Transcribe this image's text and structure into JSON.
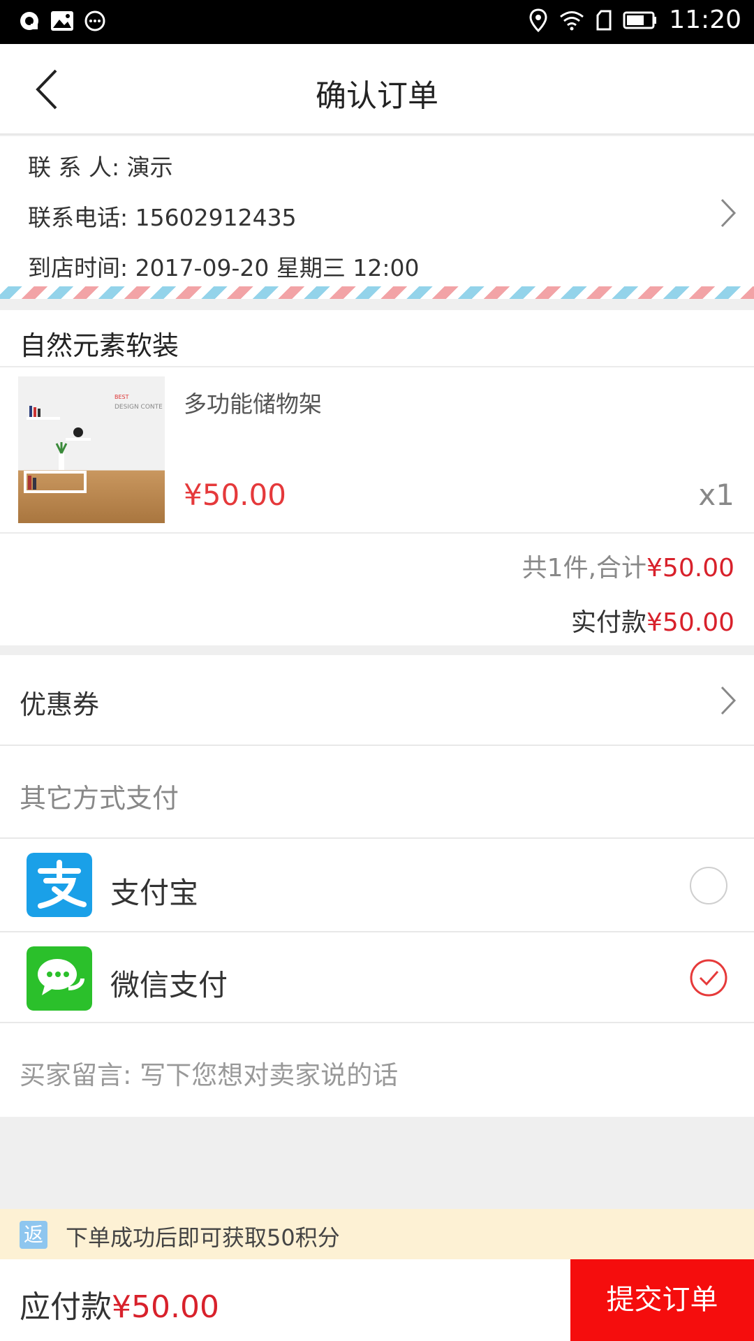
{
  "status_bar": {
    "time": "11:20"
  },
  "nav": {
    "title": "确认订单"
  },
  "contact": {
    "name_label": "联 系 人: ",
    "name": "演示",
    "phone_label": "联系电话: ",
    "phone": "15602912435",
    "time_label": "到店时间: ",
    "time": "2017-09-20 星期三 12:00"
  },
  "shop": {
    "name": "自然元素软装",
    "product": {
      "name": "多功能储物架",
      "price": "¥50.00",
      "qty": "x1",
      "image_text_1": "BEST",
      "image_text_2": "DESIGN CONTE"
    },
    "subtotal_label": "共1件,合计",
    "subtotal_value": "¥50.00",
    "actual_label": "实付款",
    "actual_value": "¥50.00"
  },
  "coupon": {
    "label": "优惠券"
  },
  "payment": {
    "section_label": "其它方式支付",
    "methods": [
      {
        "label": "支付宝",
        "icon": "alipay-icon",
        "selected": false,
        "color": "#1aa0e8"
      },
      {
        "label": "微信支付",
        "icon": "wechat-icon",
        "selected": true,
        "color": "#2bc02b"
      }
    ]
  },
  "message": {
    "placeholder": "买家留言:  写下您想对卖家说的话"
  },
  "bonus": {
    "badge": "返",
    "text": "下单成功后即可获取50积分"
  },
  "bottom": {
    "total_label": "应付款",
    "total_value": "¥50.00",
    "submit_label": "提交订单"
  }
}
